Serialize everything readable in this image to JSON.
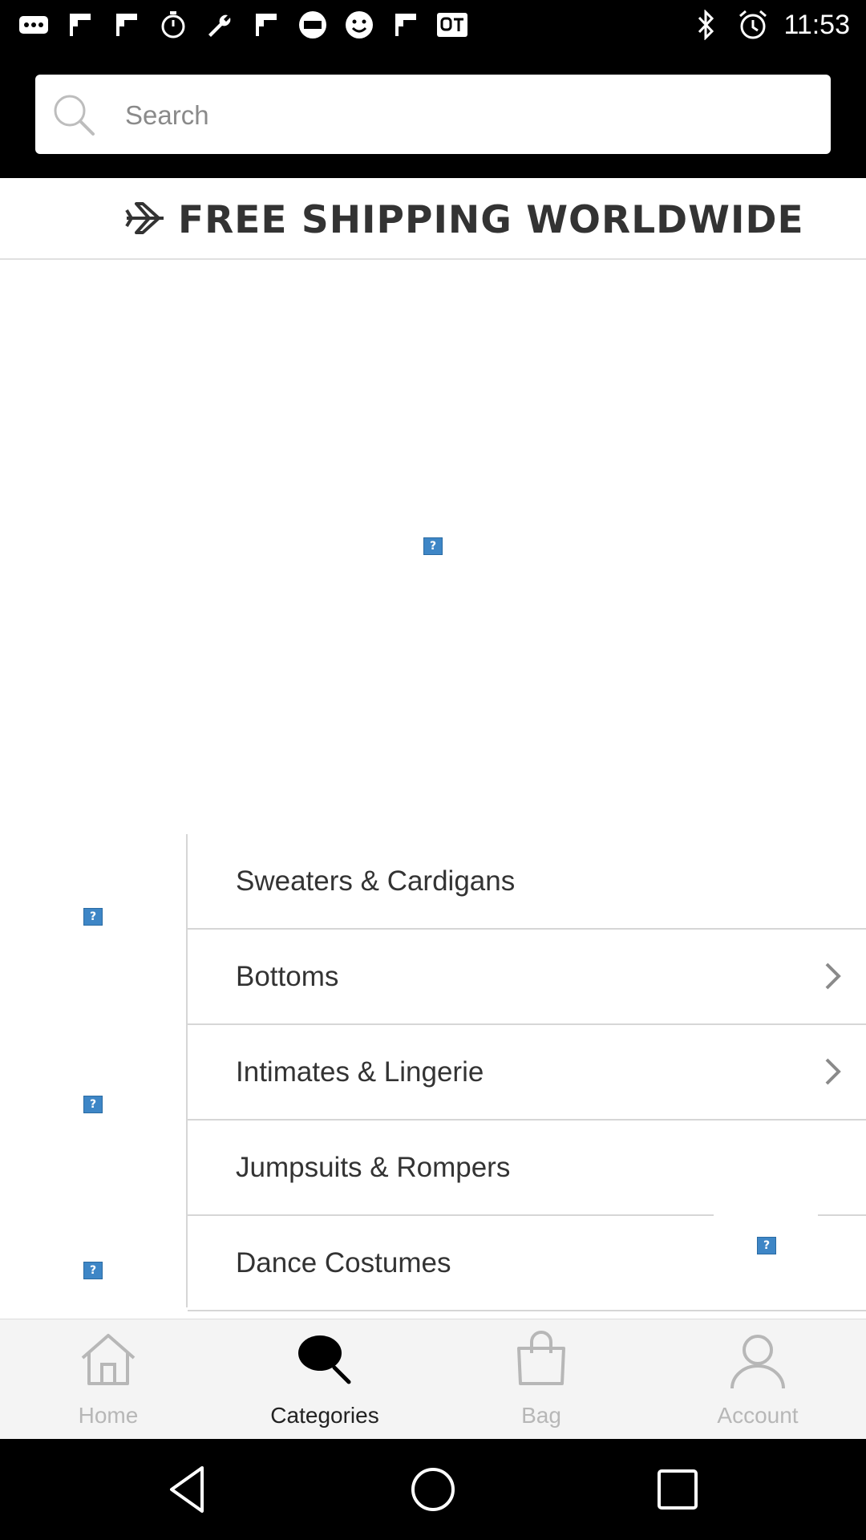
{
  "status_bar": {
    "time": "11:53",
    "left_icons": [
      "more-icon",
      "flipboard-icon",
      "flipboard-icon",
      "timer-icon",
      "wrench-icon",
      "flipboard-icon",
      "fox-sports-icon",
      "smiley-icon",
      "flipboard-icon",
      "qt-icon"
    ],
    "right_icons": [
      "bluetooth-icon",
      "alarm-icon"
    ]
  },
  "search": {
    "placeholder": "Search"
  },
  "banner": {
    "text": "FREE SHIPPING WORLDWIDE"
  },
  "categories": [
    {
      "label": "Sweaters & Cardigans",
      "has_chevron": false
    },
    {
      "label": "Bottoms",
      "has_chevron": true
    },
    {
      "label": "Intimates & Lingerie",
      "has_chevron": true
    },
    {
      "label": "Jumpsuits & Rompers",
      "has_chevron": false
    },
    {
      "label": "Dance Costumes",
      "has_chevron": false
    }
  ],
  "broken_image_glyph": "?",
  "bottom_nav": {
    "items": [
      {
        "label": "Home",
        "icon": "home-icon",
        "active": false
      },
      {
        "label": "Categories",
        "icon": "search-icon",
        "active": true
      },
      {
        "label": "Bag",
        "icon": "bag-icon",
        "active": false
      },
      {
        "label": "Account",
        "icon": "account-icon",
        "active": false
      }
    ]
  },
  "colors": {
    "accent_active": "#222222",
    "inactive": "#b7b7b7",
    "broken_image": "#3e86c6"
  }
}
